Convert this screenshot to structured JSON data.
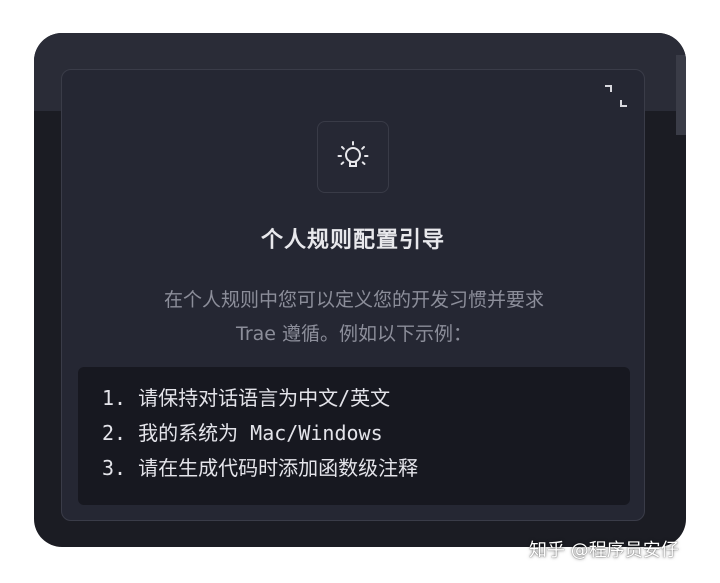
{
  "panel": {
    "icon": "lightbulb-icon",
    "collapse_icon": "collapse-icon",
    "title": "个人规则配置引导",
    "description_lines": [
      "在个人规则中您可以定义您的开发习惯并要求",
      "Trae 遵循。例如以下示例："
    ],
    "examples": [
      "1. 请保持对话语言为中文/英文",
      "2. 我的系统为 Mac/Windows",
      "3. 请在生成代码时添加函数级注释"
    ]
  },
  "watermark": "知乎 @程序员安仔",
  "colors": {
    "frame_bg": "#1b1c23",
    "card_bg": "#252733",
    "code_bg": "#171820",
    "title": "#e8e8ec",
    "muted_text": "#8c8e9a"
  }
}
